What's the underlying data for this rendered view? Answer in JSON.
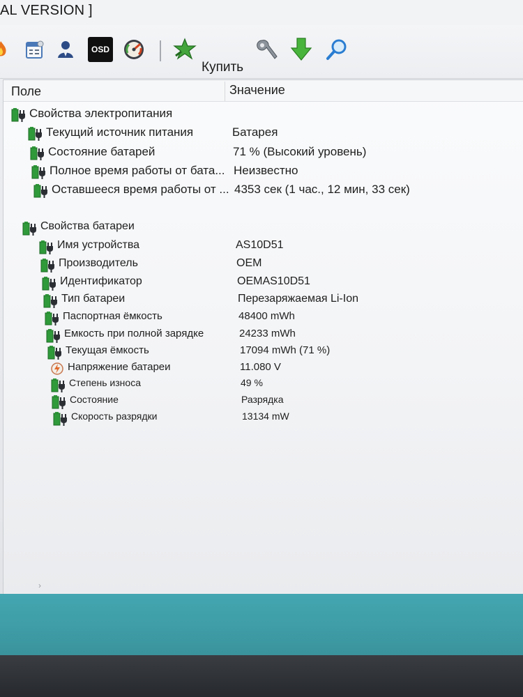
{
  "window": {
    "title": "AL VERSION ]"
  },
  "toolbar": {
    "buy_label": "Купить",
    "icons": [
      "flame-icon",
      "calendar-icon",
      "user-icon",
      "osd-icon",
      "gauge-icon",
      "buy-star-icon",
      "wrench-icon",
      "download-icon",
      "search-icon"
    ],
    "osd_text": "OSD"
  },
  "columns": {
    "field": "Поле",
    "value": "Значение"
  },
  "power_section": {
    "title": "Свойства электропитания",
    "rows": [
      {
        "field": "Текущий источник питания",
        "value": "Батарея"
      },
      {
        "field": "Состояние батарей",
        "value": "71 % (Высокий уровень)"
      },
      {
        "field": "Полное время работы от бата...",
        "value": "Неизвестно"
      },
      {
        "field": "Оставшееся время работы от ...",
        "value": "4353 сек (1 час., 12 мин, 33 сек)"
      }
    ]
  },
  "battery_section": {
    "title": "Свойства батареи",
    "rows": [
      {
        "field": "Имя устройства",
        "value": "AS10D51"
      },
      {
        "field": "Производитель",
        "value": "OEM"
      },
      {
        "field": "Идентификатор",
        "value": "OEMAS10D51"
      },
      {
        "field": "Тип батареи",
        "value": "Перезаряжаемая Li-Ion"
      },
      {
        "field": "Паспортная ёмкость",
        "value": "48400 mWh"
      },
      {
        "field": "Емкость при полной зарядке",
        "value": "24233 mWh"
      },
      {
        "field": "Текущая ёмкость",
        "value": "17094 mWh  (71 %)"
      },
      {
        "field": "Напряжение батареи",
        "value": "11.080 V"
      },
      {
        "field": "Степень износа",
        "value": "49 %"
      },
      {
        "field": "Состояние",
        "value": "Разрядка"
      },
      {
        "field": "Скорость разрядки",
        "value": "13134 mW"
      }
    ]
  },
  "colors": {
    "battery_green": "#2f9a3a",
    "plug_dark": "#2b2f34",
    "taskbar_teal": "#3f9ea8"
  }
}
